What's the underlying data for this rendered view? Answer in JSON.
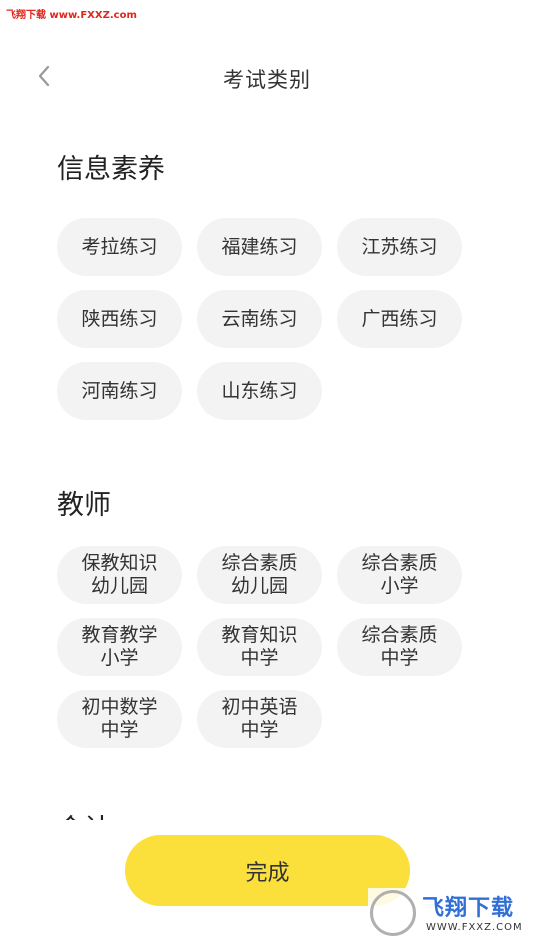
{
  "watermark": {
    "top_text": "飞翔下载 www.FXXZ.com",
    "logo_text": "飞翔下载",
    "logo_url": "WWW.FXXZ.COM"
  },
  "header": {
    "title": "考试类别",
    "back_icon": "chevron-left-icon"
  },
  "sections": [
    {
      "title": "信息素养",
      "chips": [
        {
          "line1": "考拉练习",
          "line2": ""
        },
        {
          "line1": "福建练习",
          "line2": ""
        },
        {
          "line1": "江苏练习",
          "line2": ""
        },
        {
          "line1": "陕西练习",
          "line2": ""
        },
        {
          "line1": "云南练习",
          "line2": ""
        },
        {
          "line1": "广西练习",
          "line2": ""
        },
        {
          "line1": "河南练习",
          "line2": ""
        },
        {
          "line1": "山东练习",
          "line2": ""
        }
      ]
    },
    {
      "title": "教师",
      "chips": [
        {
          "line1": "保教知识",
          "line2": "幼儿园"
        },
        {
          "line1": "综合素质",
          "line2": "幼儿园"
        },
        {
          "line1": "综合素质",
          "line2": "小学"
        },
        {
          "line1": "教育教学",
          "line2": "小学"
        },
        {
          "line1": "教育知识",
          "line2": "中学"
        },
        {
          "line1": "综合素质",
          "line2": "中学"
        },
        {
          "line1": "初中数学",
          "line2": "中学"
        },
        {
          "line1": "初中英语",
          "line2": "中学"
        }
      ]
    },
    {
      "title": "会计",
      "chips": []
    }
  ],
  "footer": {
    "done_label": "完成"
  },
  "colors": {
    "accent": "#fbe03c",
    "chip_bg": "#f3f3f3",
    "text": "#333333"
  }
}
